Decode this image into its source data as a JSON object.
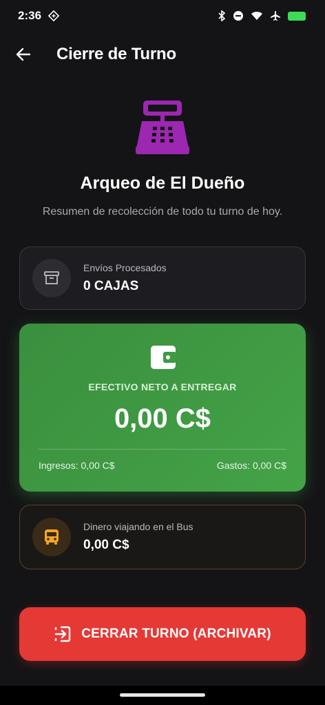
{
  "status": {
    "time": "2:36"
  },
  "appbar": {
    "title": "Cierre de Turno"
  },
  "header": {
    "title": "Arqueo de El Dueño",
    "subtitle": "Resumen de recolección de todo tu turno de hoy."
  },
  "envios": {
    "label": "Envíos Procesados",
    "value": "0 CAJAS"
  },
  "efectivo": {
    "label": "EFECTIVO NETO A ENTREGAR",
    "amount": "0,00 C$",
    "ingresos": "Ingresos: 0,00 C$",
    "gastos": "Gastos: 0,00 C$"
  },
  "bus": {
    "label": "Dinero viajando en el Bus",
    "value": "0,00 C$"
  },
  "action": {
    "label": "CERRAR TURNO (ARCHIVAR)"
  },
  "colors": {
    "accent_purple": "#9c27b0",
    "green": "#43a047",
    "red": "#e53935",
    "bus_orange": "#f5a623"
  }
}
